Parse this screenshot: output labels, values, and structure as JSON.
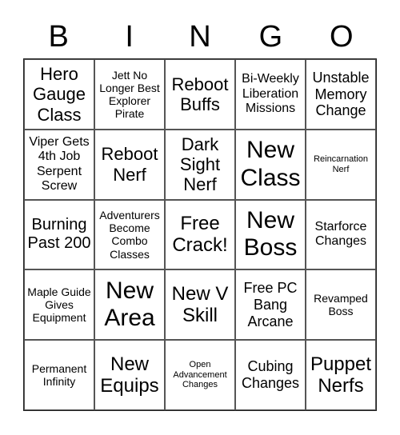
{
  "header": {
    "letters": [
      "B",
      "I",
      "N",
      "G",
      "O"
    ]
  },
  "board": {
    "cells": [
      "Hero Gauge Class",
      "Jett No Longer Best Explorer Pirate",
      "Reboot Buffs",
      "Bi-Weekly Liberation Missions",
      "Unstable Memory Change",
      "Viper Gets 4th Job Serpent Screw",
      "Reboot Nerf",
      "Dark Sight Nerf",
      "New Class",
      "Reincarnation Nerf",
      "Burning Past 200",
      "Adventurers Become Combo Classes",
      "Free Crack!",
      "New Boss",
      "Starforce Changes",
      "Maple Guide Gives Equipment",
      "New Area",
      "New V Skill",
      "Free PC Bang Arcane",
      "Revamped Boss",
      "Permanent Infinity",
      "New Equips",
      "Open Advancement Changes",
      "Cubing Changes",
      "Puppet Nerfs"
    ]
  }
}
